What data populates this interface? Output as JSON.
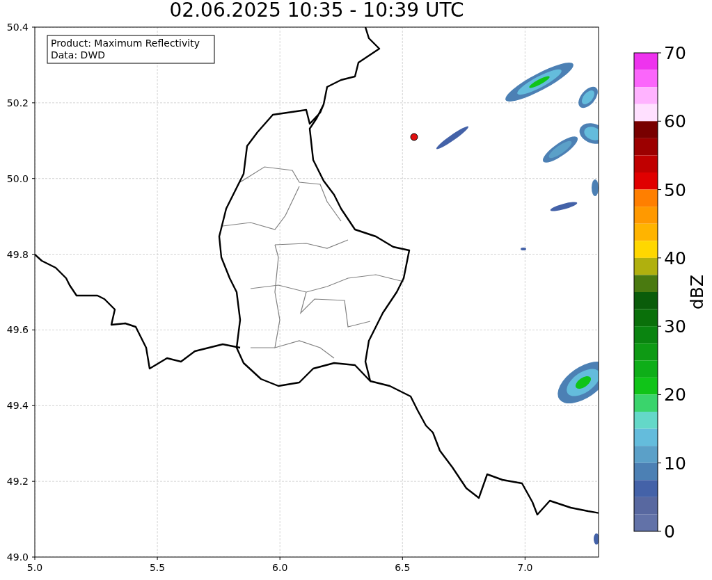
{
  "title": "02.06.2025 10:35 - 10:39 UTC",
  "legend": [
    "Product: Maximum Reflectivity",
    "Data: DWD"
  ],
  "map": {
    "xticks": [
      "5.0",
      "5.5",
      "6.0",
      "6.5",
      "7.0"
    ],
    "yticks": [
      "50.4",
      "50.2",
      "50.0",
      "49.8",
      "49.6",
      "49.4",
      "49.2",
      "49.0"
    ]
  },
  "colorbar": {
    "label": "dBZ",
    "ticks": [
      "70",
      "60",
      "50",
      "40",
      "30",
      "20",
      "10",
      "0"
    ],
    "segments": [
      {
        "color": "#ee33ee"
      },
      {
        "color": "#fb66fb"
      },
      {
        "color": "#ffb3ff"
      },
      {
        "color": "#ffe0ff"
      },
      {
        "color": "#780000"
      },
      {
        "color": "#9c0000"
      },
      {
        "color": "#c00000"
      },
      {
        "color": "#e00000"
      },
      {
        "color": "#ff7f00"
      },
      {
        "color": "#ff9900"
      },
      {
        "color": "#ffb400"
      },
      {
        "color": "#ffd700"
      },
      {
        "color": "#b0b00e"
      },
      {
        "color": "#4a7a10"
      },
      {
        "color": "#0a5c0a"
      },
      {
        "color": "#0a700a"
      },
      {
        "color": "#0a8410"
      },
      {
        "color": "#0e9a14"
      },
      {
        "color": "#0eae18"
      },
      {
        "color": "#10c418"
      },
      {
        "color": "#3ad46c"
      },
      {
        "color": "#64d8c8"
      },
      {
        "color": "#64bcdc"
      },
      {
        "color": "#5ba0c8"
      },
      {
        "color": "#4c80b4"
      },
      {
        "color": "#4462a8"
      },
      {
        "color": "#5868a0"
      },
      {
        "color": "#6272a8"
      }
    ]
  }
}
